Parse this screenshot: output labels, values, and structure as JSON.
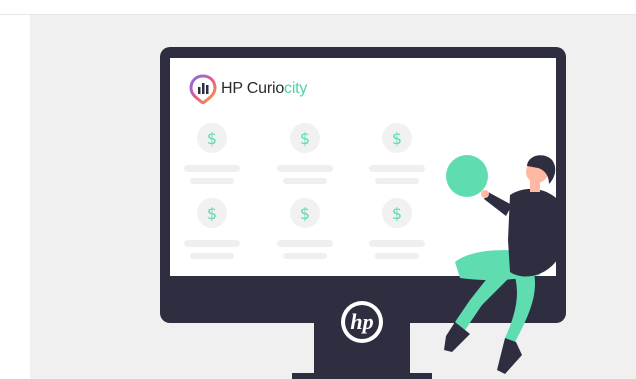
{
  "brand": {
    "name_main": "HP Curio",
    "name_accent": "city"
  },
  "cards": {
    "symbol": "$",
    "count": 6
  },
  "monitor": {
    "logo": "hp-logo"
  },
  "colors": {
    "accent": "#5fdcb0",
    "dark": "#2f2e41",
    "panel": "#f0f0f0"
  }
}
